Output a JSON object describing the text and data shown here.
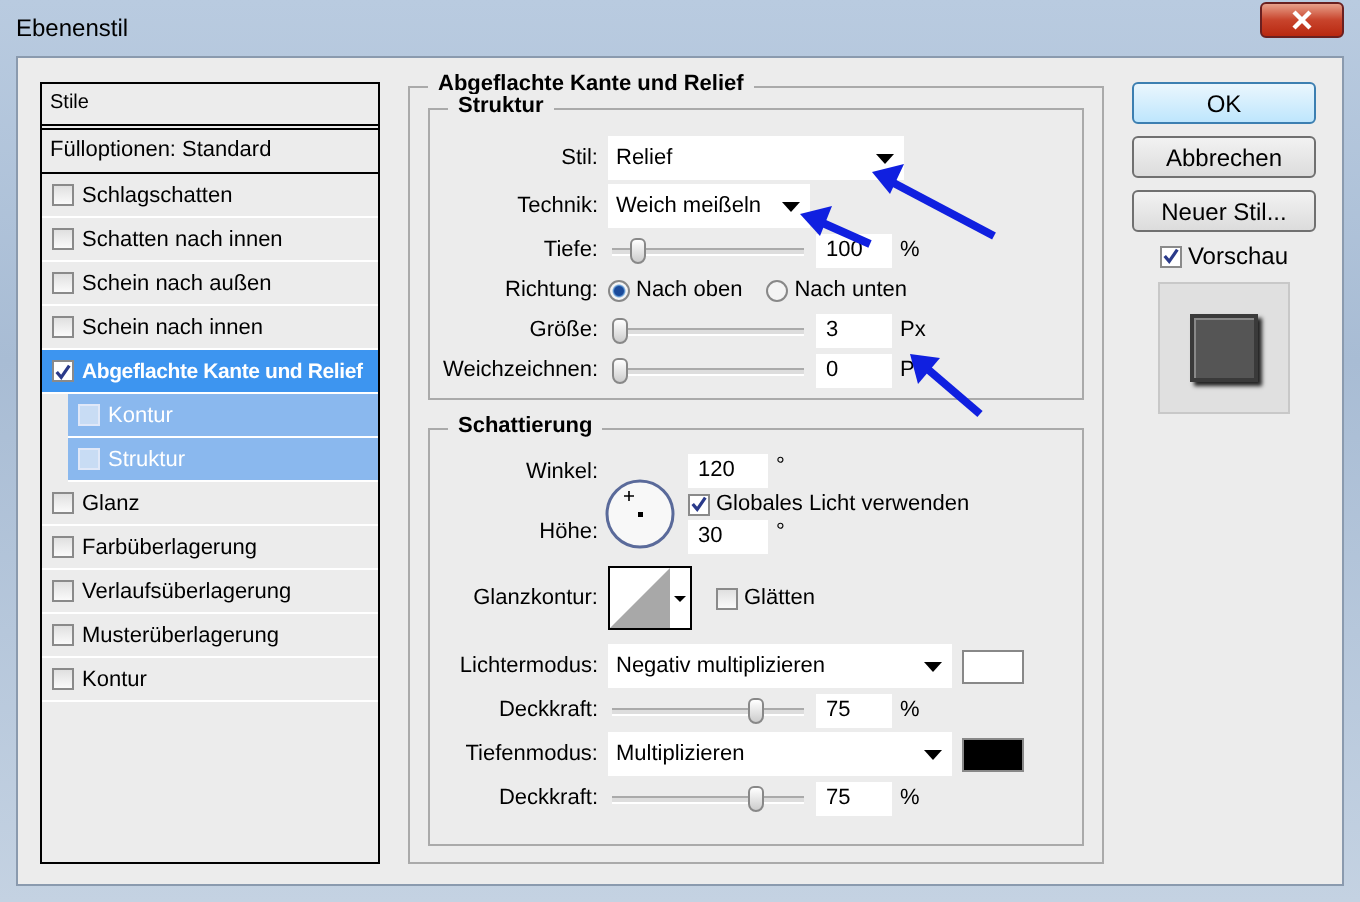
{
  "window": {
    "title": "Ebenenstil"
  },
  "styles_panel": {
    "header": "Stile",
    "blend_options": "Fülloptionen: Standard",
    "items": [
      {
        "label": "Schlagschatten",
        "checked": false,
        "selected": false
      },
      {
        "label": "Schatten nach innen",
        "checked": false,
        "selected": false
      },
      {
        "label": "Schein nach außen",
        "checked": false,
        "selected": false
      },
      {
        "label": "Schein nach innen",
        "checked": false,
        "selected": false
      },
      {
        "label": "Abgeflachte Kante und Relief",
        "checked": true,
        "selected": true,
        "children": [
          {
            "label": "Kontur",
            "checked": false,
            "selected": false
          },
          {
            "label": "Struktur",
            "checked": false,
            "selected": false
          }
        ]
      },
      {
        "label": "Glanz",
        "checked": false,
        "selected": false
      },
      {
        "label": "Farbüberlagerung",
        "checked": false,
        "selected": false
      },
      {
        "label": "Verlaufsüberlagerung",
        "checked": false,
        "selected": false
      },
      {
        "label": "Musterüberlagerung",
        "checked": false,
        "selected": false
      },
      {
        "label": "Kontur",
        "checked": false,
        "selected": false
      }
    ]
  },
  "main": {
    "title": "Abgeflachte Kante und Relief",
    "structure": {
      "title": "Struktur",
      "rows": [
        {
          "kind": "dropdown",
          "label": "Stil:",
          "value": "Relief",
          "wide": true
        },
        {
          "kind": "dropdown",
          "label": "Technik:",
          "value": "Weich meißeln",
          "wide": false
        },
        {
          "kind": "slider",
          "label": "Tiefe:",
          "level": 0.1,
          "value": "100",
          "unit": "%"
        },
        {
          "kind": "radio",
          "label": "Richtung:",
          "options": [
            {
              "label": "Nach oben",
              "selected": true
            },
            {
              "label": "Nach unten",
              "selected": false
            }
          ]
        },
        {
          "kind": "slider",
          "label": "Größe:",
          "level": 0,
          "value": "3",
          "unit": "Px"
        },
        {
          "kind": "slider",
          "label": "Weichzeichnen:",
          "level": 0,
          "value": "0",
          "unit": "P"
        }
      ]
    },
    "shading": {
      "title": "Schattierung",
      "angle": {
        "label": "Winkel:",
        "value": "120",
        "unit": "°"
      },
      "global_light": {
        "label": "Globales Licht verwenden",
        "checked": true
      },
      "altitude": {
        "label": "Höhe:",
        "value": "30",
        "unit": "°"
      },
      "gloss_contour": {
        "label": "Glanzkontur:"
      },
      "anti_alias": {
        "label": "Glätten",
        "checked": false
      },
      "modes": [
        {
          "label": "Lichtermodus:",
          "value": "Negativ multiplizieren",
          "color": "#ffffff",
          "opacity": {
            "label": "Deckkraft:",
            "level": 0.77,
            "value": "75",
            "unit": "%"
          }
        },
        {
          "label": "Tiefenmodus:",
          "value": "Multiplizieren",
          "color": "#000000",
          "opacity": {
            "label": "Deckkraft:",
            "level": 0.77,
            "value": "75",
            "unit": "%"
          }
        }
      ]
    }
  },
  "buttons": [
    {
      "label": "OK",
      "default": true
    },
    {
      "label": "Abbrechen",
      "default": false
    },
    {
      "label": "Neuer Stil...",
      "default": false
    }
  ],
  "preview": {
    "label": "Vorschau",
    "checked": true
  }
}
